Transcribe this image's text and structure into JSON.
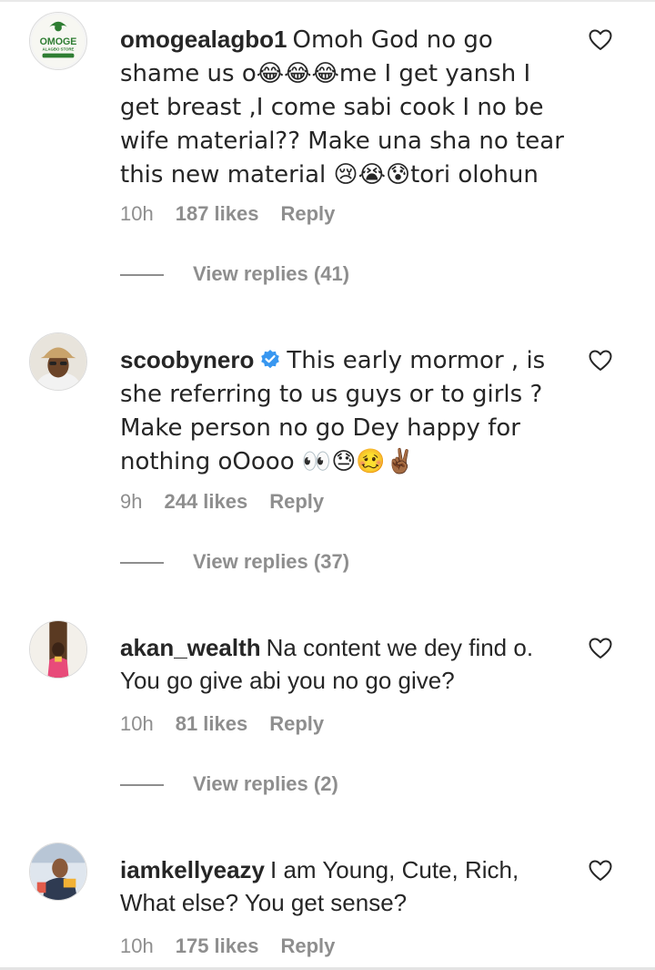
{
  "comments": [
    {
      "username": "omogealagbo1",
      "avatar_icon": "omoge-store-logo",
      "avatar_text": "OMOGE",
      "avatar_subtext": "ALAGBO STORE",
      "verified": false,
      "text": "Omoh God no go shame us o😂😂😂me I get yansh I get breast ,I come sabi cook I no be wife material?? Make una sha no tear this new material 😢😭😰tori olohun",
      "time": "10h",
      "likes": "187 likes",
      "reply_label": "Reply",
      "view_replies": "View replies (41)"
    },
    {
      "username": "scoobynero",
      "avatar_icon": "user-photo-avatar",
      "verified": true,
      "text": "This early mormor , is she referring to us guys or to girls ? Make person no go Dey happy for nothing oOooo 👀😓🥴✌🏾",
      "time": "9h",
      "likes": "244 likes",
      "reply_label": "Reply",
      "view_replies": "View replies (37)"
    },
    {
      "username": "akan_wealth",
      "avatar_icon": "user-photo-avatar",
      "verified": false,
      "text": "Na content we dey find o. You go give abi you no go give?",
      "time": "10h",
      "likes": "81 likes",
      "reply_label": "Reply",
      "view_replies": "View replies (2)"
    },
    {
      "username": "iamkellyeazy",
      "avatar_icon": "user-photo-avatar",
      "verified": false,
      "text": "I am Young, Cute, Rich, What else? You get sense?",
      "time": "10h",
      "likes": "175 likes",
      "reply_label": "Reply"
    }
  ],
  "colors": {
    "text": "#262626",
    "secondary": "#8e8e8e",
    "verified_blue": "#3897f0",
    "brand_green": "#2e7d32"
  },
  "icons": {
    "like": "heart-outline-icon",
    "verified": "verified-badge-icon"
  }
}
